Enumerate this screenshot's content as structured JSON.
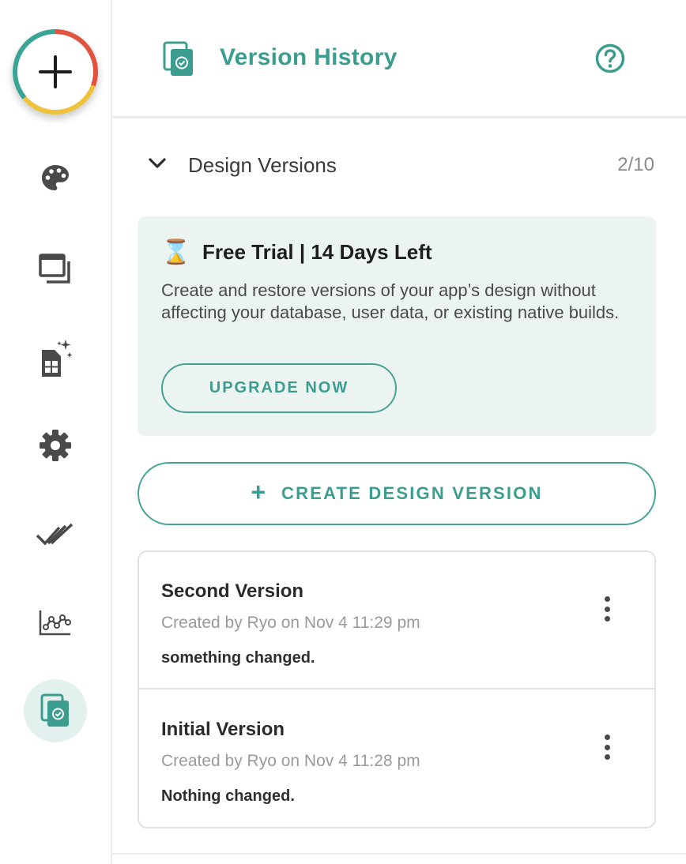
{
  "colors": {
    "accent": "#3c9d8f",
    "trial_bg": "#ecf4f2",
    "active_bg": "#e3f1ee",
    "icon_gray": "#4a4a4a"
  },
  "sidebar": {
    "add_button": {
      "icon": "plus-icon"
    },
    "items": [
      {
        "name": "design",
        "icon": "palette-icon"
      },
      {
        "name": "screens",
        "icon": "screens-icon"
      },
      {
        "name": "database",
        "icon": "database-sparkle-icon"
      },
      {
        "name": "settings",
        "icon": "gear-icon"
      },
      {
        "name": "publish",
        "icon": "double-check-icon"
      },
      {
        "name": "analytics",
        "icon": "chart-icon"
      },
      {
        "name": "version-history",
        "icon": "version-history-icon",
        "active": true
      }
    ]
  },
  "header": {
    "title": "Version History",
    "icon": "version-history-icon",
    "help_icon": "help-icon"
  },
  "section": {
    "label": "Design Versions",
    "count": "2/10"
  },
  "trial": {
    "emoji": "⌛",
    "title": "Free Trial | 14 Days Left",
    "description": "Create and restore versions of your app’s design without affecting your database, user data, or existing native builds.",
    "upgrade_label": "UPGRADE NOW"
  },
  "create_button": {
    "plus": "+",
    "label": "CREATE DESIGN VERSION"
  },
  "versions": [
    {
      "name": "Second Version",
      "meta": "Created by Ryo on Nov 4 11:29 pm",
      "note": "something changed."
    },
    {
      "name": "Initial Version",
      "meta": "Created by Ryo on Nov 4 11:28 pm",
      "note": "Nothing changed."
    }
  ]
}
